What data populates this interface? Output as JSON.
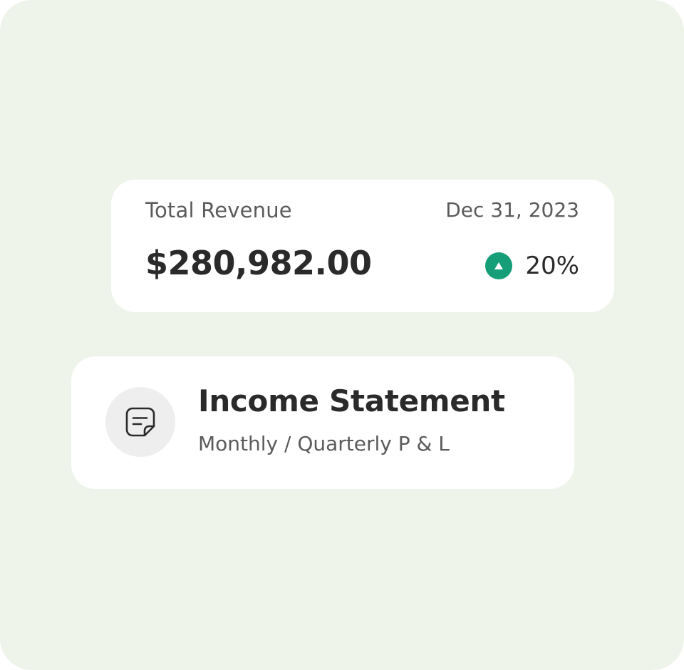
{
  "revenue_card": {
    "title": "Total Revenue",
    "date": "Dec 31, 2023",
    "amount": "$280,982.00",
    "change_percent": "20%",
    "trend_icon": "triangle-up-icon",
    "trend_color": "#159e77"
  },
  "statement_card": {
    "icon": "document-icon",
    "title": "Income Statement",
    "subtitle": "Monthly / Quarterly P & L"
  },
  "colors": {
    "background": "#eff4ea",
    "card": "#ffffff",
    "text_primary": "#2a2a2a",
    "text_secondary": "#5b5b5b",
    "icon_bg": "#eeeeee"
  }
}
